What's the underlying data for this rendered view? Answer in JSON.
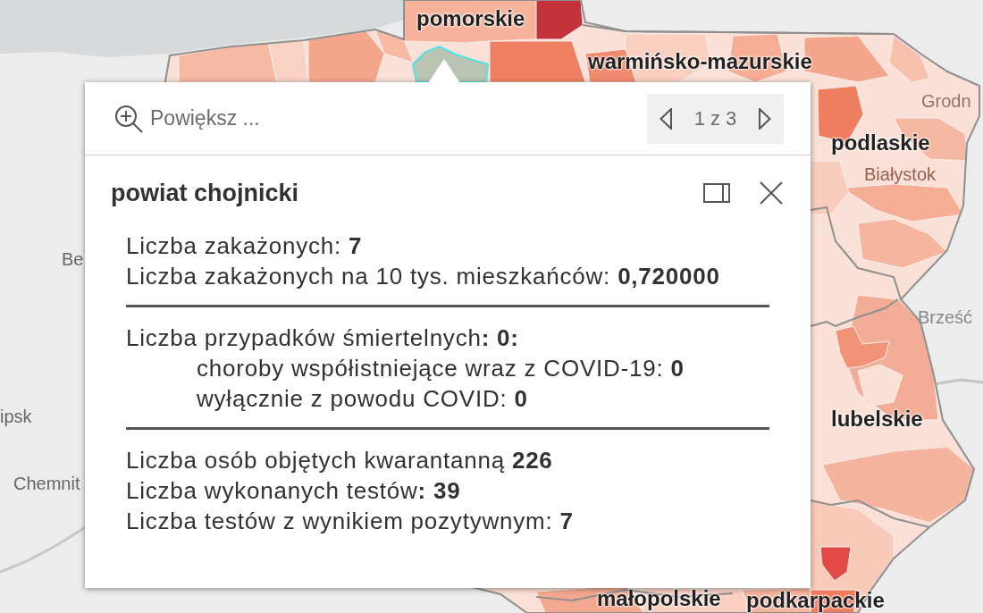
{
  "map": {
    "region_labels": [
      "pomorskie",
      "warmińsko-mazurskie",
      "podlaskie",
      "lubelskie",
      "małopolskie",
      "podkarpackie"
    ],
    "place_labels": [
      "Grodn",
      "Białystok",
      "Brześć",
      "Be",
      "ipsk",
      "Chemnit"
    ]
  },
  "popup": {
    "zoom_action": "Powiększ ...",
    "pager": "1 z 3",
    "title": "powiat chojnicki",
    "sections": [
      {
        "lines": [
          {
            "text": "Liczba zakażonych: **7**"
          },
          {
            "text": "Liczba zakażonych na 10 tys. mieszkańców: **0,720000**"
          }
        ]
      },
      {
        "lines": [
          {
            "text": "Liczba przypadków śmiertelnych**: 0:**",
            "children": [
              {
                "text": "choroby współistniejące wraz z COVID-19: **0**"
              },
              {
                "text": "wyłącznie z powodu COVID: **0**"
              }
            ]
          }
        ]
      },
      {
        "lines": [
          {
            "text": "Liczba osób objętych kwarantanną **226**"
          },
          {
            "text": "Liczba wykonanych testów**: 39**"
          },
          {
            "text": "Liczba testów z wynikiem pozytywnym: **7**"
          }
        ]
      }
    ]
  }
}
